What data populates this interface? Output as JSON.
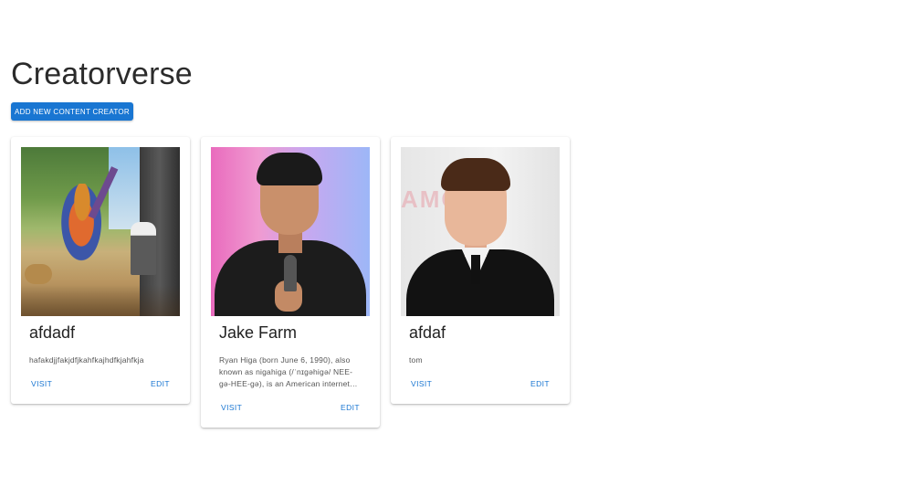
{
  "app": {
    "title": "Creatorverse",
    "add_button_label": "ADD NEW CONTENT CREATOR"
  },
  "creators": [
    {
      "name": "afdadf",
      "description": "hafakdjjfakjdfjkahfkajhdfkjahfkja",
      "visit_label": "VISIT",
      "edit_label": "EDIT"
    },
    {
      "name": "Jake Farm",
      "description": "Ryan Higa (born June 6, 1990), also known as nigahiga (/ˈnɪɡəhiɡə/ NEE-gə-HEE-gə), is an American internet…",
      "visit_label": "VISIT",
      "edit_label": "EDIT"
    },
    {
      "name": "afdaf",
      "description": "tom",
      "visit_label": "VISIT",
      "edit_label": "EDIT"
    }
  ],
  "photo_logo_text": "AMC OS",
  "colors": {
    "accent": "#1976d2",
    "background": "#ffffff"
  }
}
